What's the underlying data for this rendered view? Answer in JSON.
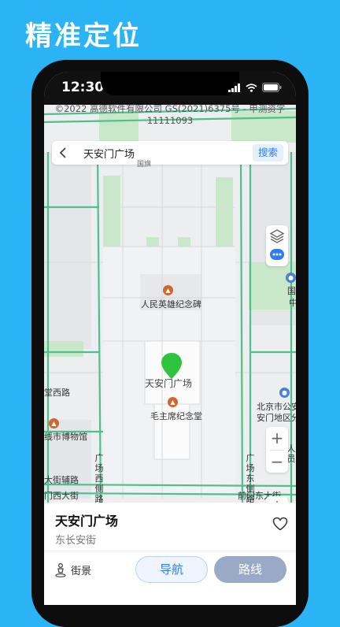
{
  "promo": {
    "headline": "精准定位"
  },
  "status_bar": {
    "time": "12:30"
  },
  "map": {
    "copyright_line1": "©2022 高德软件有限公司 GS(2021)6375号 - 甲测资字",
    "copyright_line2": "11111093",
    "search": {
      "value": "天安门广场",
      "button": "搜索"
    },
    "labels": {
      "monument": "人民英雄纪念碑",
      "square": "天安门广场",
      "mausoleum": "毛主席纪念堂",
      "museum": "线市博物馆",
      "west_road": "堂西路",
      "police_line1": "北京市公安",
      "police_line2": "安门地区分",
      "nat_line1": "国",
      "nat_line2": "中",
      "west_side_road": "广场西侧路",
      "east_side_road": "广场东侧路",
      "right_partial": "人员",
      "aux_road": "大街辅路",
      "front_west": "门西大街",
      "front_east": "前门东大街",
      "road_tag": "国旗"
    }
  },
  "place": {
    "title": "天安门广场",
    "subtitle": "东长安街",
    "street_view": "街景",
    "navigate": "导航",
    "route": "路线"
  },
  "colors": {
    "accent": "#2f7cf6",
    "pin": "#2fc43e",
    "road": "#4fc08d",
    "background": "#2ab4f5"
  }
}
